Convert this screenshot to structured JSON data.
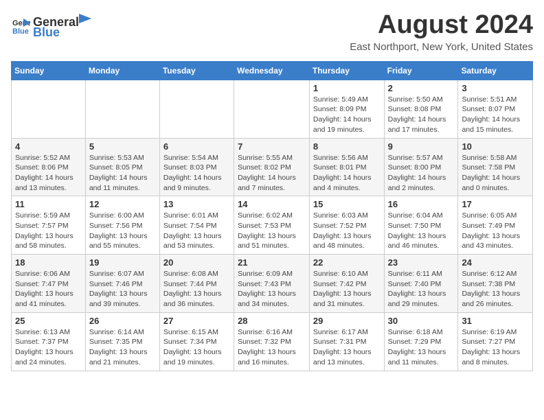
{
  "header": {
    "logo_general": "General",
    "logo_blue": "Blue",
    "main_title": "August 2024",
    "subtitle": "East Northport, New York, United States"
  },
  "days_of_week": [
    "Sunday",
    "Monday",
    "Tuesday",
    "Wednesday",
    "Thursday",
    "Friday",
    "Saturday"
  ],
  "weeks": [
    [
      {
        "day": "",
        "info": ""
      },
      {
        "day": "",
        "info": ""
      },
      {
        "day": "",
        "info": ""
      },
      {
        "day": "",
        "info": ""
      },
      {
        "day": "1",
        "info": "Sunrise: 5:49 AM\nSunset: 8:09 PM\nDaylight: 14 hours\nand 19 minutes."
      },
      {
        "day": "2",
        "info": "Sunrise: 5:50 AM\nSunset: 8:08 PM\nDaylight: 14 hours\nand 17 minutes."
      },
      {
        "day": "3",
        "info": "Sunrise: 5:51 AM\nSunset: 8:07 PM\nDaylight: 14 hours\nand 15 minutes."
      }
    ],
    [
      {
        "day": "4",
        "info": "Sunrise: 5:52 AM\nSunset: 8:06 PM\nDaylight: 14 hours\nand 13 minutes."
      },
      {
        "day": "5",
        "info": "Sunrise: 5:53 AM\nSunset: 8:05 PM\nDaylight: 14 hours\nand 11 minutes."
      },
      {
        "day": "6",
        "info": "Sunrise: 5:54 AM\nSunset: 8:03 PM\nDaylight: 14 hours\nand 9 minutes."
      },
      {
        "day": "7",
        "info": "Sunrise: 5:55 AM\nSunset: 8:02 PM\nDaylight: 14 hours\nand 7 minutes."
      },
      {
        "day": "8",
        "info": "Sunrise: 5:56 AM\nSunset: 8:01 PM\nDaylight: 14 hours\nand 4 minutes."
      },
      {
        "day": "9",
        "info": "Sunrise: 5:57 AM\nSunset: 8:00 PM\nDaylight: 14 hours\nand 2 minutes."
      },
      {
        "day": "10",
        "info": "Sunrise: 5:58 AM\nSunset: 7:58 PM\nDaylight: 14 hours\nand 0 minutes."
      }
    ],
    [
      {
        "day": "11",
        "info": "Sunrise: 5:59 AM\nSunset: 7:57 PM\nDaylight: 13 hours\nand 58 minutes."
      },
      {
        "day": "12",
        "info": "Sunrise: 6:00 AM\nSunset: 7:56 PM\nDaylight: 13 hours\nand 55 minutes."
      },
      {
        "day": "13",
        "info": "Sunrise: 6:01 AM\nSunset: 7:54 PM\nDaylight: 13 hours\nand 53 minutes."
      },
      {
        "day": "14",
        "info": "Sunrise: 6:02 AM\nSunset: 7:53 PM\nDaylight: 13 hours\nand 51 minutes."
      },
      {
        "day": "15",
        "info": "Sunrise: 6:03 AM\nSunset: 7:52 PM\nDaylight: 13 hours\nand 48 minutes."
      },
      {
        "day": "16",
        "info": "Sunrise: 6:04 AM\nSunset: 7:50 PM\nDaylight: 13 hours\nand 46 minutes."
      },
      {
        "day": "17",
        "info": "Sunrise: 6:05 AM\nSunset: 7:49 PM\nDaylight: 13 hours\nand 43 minutes."
      }
    ],
    [
      {
        "day": "18",
        "info": "Sunrise: 6:06 AM\nSunset: 7:47 PM\nDaylight: 13 hours\nand 41 minutes."
      },
      {
        "day": "19",
        "info": "Sunrise: 6:07 AM\nSunset: 7:46 PM\nDaylight: 13 hours\nand 39 minutes."
      },
      {
        "day": "20",
        "info": "Sunrise: 6:08 AM\nSunset: 7:44 PM\nDaylight: 13 hours\nand 36 minutes."
      },
      {
        "day": "21",
        "info": "Sunrise: 6:09 AM\nSunset: 7:43 PM\nDaylight: 13 hours\nand 34 minutes."
      },
      {
        "day": "22",
        "info": "Sunrise: 6:10 AM\nSunset: 7:42 PM\nDaylight: 13 hours\nand 31 minutes."
      },
      {
        "day": "23",
        "info": "Sunrise: 6:11 AM\nSunset: 7:40 PM\nDaylight: 13 hours\nand 29 minutes."
      },
      {
        "day": "24",
        "info": "Sunrise: 6:12 AM\nSunset: 7:38 PM\nDaylight: 13 hours\nand 26 minutes."
      }
    ],
    [
      {
        "day": "25",
        "info": "Sunrise: 6:13 AM\nSunset: 7:37 PM\nDaylight: 13 hours\nand 24 minutes."
      },
      {
        "day": "26",
        "info": "Sunrise: 6:14 AM\nSunset: 7:35 PM\nDaylight: 13 hours\nand 21 minutes."
      },
      {
        "day": "27",
        "info": "Sunrise: 6:15 AM\nSunset: 7:34 PM\nDaylight: 13 hours\nand 19 minutes."
      },
      {
        "day": "28",
        "info": "Sunrise: 6:16 AM\nSunset: 7:32 PM\nDaylight: 13 hours\nand 16 minutes."
      },
      {
        "day": "29",
        "info": "Sunrise: 6:17 AM\nSunset: 7:31 PM\nDaylight: 13 hours\nand 13 minutes."
      },
      {
        "day": "30",
        "info": "Sunrise: 6:18 AM\nSunset: 7:29 PM\nDaylight: 13 hours\nand 11 minutes."
      },
      {
        "day": "31",
        "info": "Sunrise: 6:19 AM\nSunset: 7:27 PM\nDaylight: 13 hours\nand 8 minutes."
      }
    ]
  ]
}
